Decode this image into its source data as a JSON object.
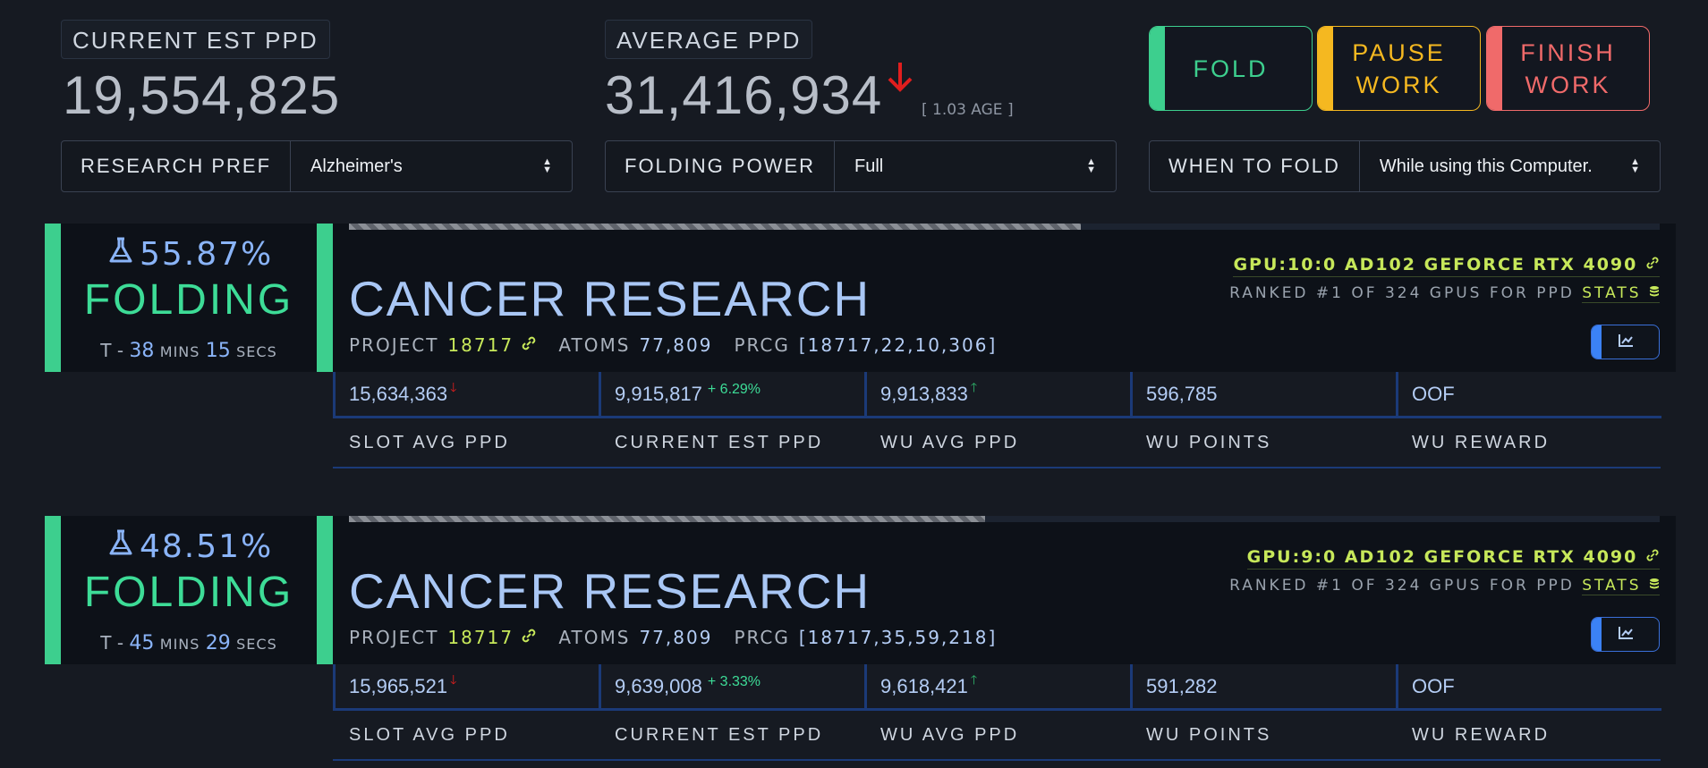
{
  "header": {
    "current_est_label": "CURRENT EST PPD",
    "current_est_value": "19,554,825",
    "average_label": "AVERAGE PPD",
    "average_value": "31,416,934",
    "average_trend": "down",
    "age": "[ 1.03 AGE ]",
    "buttons": [
      {
        "label": "FOLD",
        "color": "#3dcf8e"
      },
      {
        "label": "PAUSE\nWORK",
        "color": "#f5b820"
      },
      {
        "label": "FINISH\nWORK",
        "color": "#f06a6a"
      }
    ],
    "selects": [
      {
        "label": "RESEARCH PREF",
        "value": "Alzheimer's"
      },
      {
        "label": "FOLDING POWER",
        "value": "Full"
      },
      {
        "label": "WHEN TO FOLD",
        "value": "While using this Computer."
      }
    ]
  },
  "stat_labels": [
    "SLOT AVG PPD",
    "CURRENT EST PPD",
    "WU AVG PPD",
    "WU POINTS",
    "WU REWARD"
  ],
  "slots": [
    {
      "percent": "55.87%",
      "progress": 0.5587,
      "status": "FOLDING",
      "eta": {
        "prefix": "T - ",
        "mins": "38",
        "mins_unit": "MINS",
        "secs": "15",
        "secs_unit": "SECS"
      },
      "title": "CANCER RESEARCH",
      "project_label": "PROJECT",
      "project": "18717",
      "atoms_label": "ATOMS",
      "atoms": "77,809",
      "prcg_label": "PRCG",
      "prcg": "[18717,22,10,306]",
      "gpu": "GPU:10:0 AD102 GEFORCE RTX 4090",
      "rank": "RANKED #1 OF 324 GPUS FOR PPD",
      "stats_link": "STATS",
      "slot_avg_ppd": "15,634,363",
      "current_est_ppd": "9,915,817",
      "current_est_change": "+ 6.29%",
      "wu_avg_ppd": "9,913,833",
      "wu_points": "596,785",
      "wu_reward": "OOF"
    },
    {
      "percent": "48.51%",
      "progress": 0.4851,
      "status": "FOLDING",
      "eta": {
        "prefix": "T - ",
        "mins": "45",
        "mins_unit": "MINS",
        "secs": "29",
        "secs_unit": "SECS"
      },
      "title": "CANCER RESEARCH",
      "project_label": "PROJECT",
      "project": "18717",
      "atoms_label": "ATOMS",
      "atoms": "77,809",
      "prcg_label": "PRCG",
      "prcg": "[18717,35,59,218]",
      "gpu": "GPU:9:0 AD102 GEFORCE RTX 4090",
      "rank": "RANKED #1 OF 324 GPUS FOR PPD",
      "stats_link": "STATS",
      "slot_avg_ppd": "15,965,521",
      "current_est_ppd": "9,639,008",
      "current_est_change": "+ 3.33%",
      "wu_avg_ppd": "9,618,421",
      "wu_points": "591,282",
      "wu_reward": "OOF"
    }
  ]
}
